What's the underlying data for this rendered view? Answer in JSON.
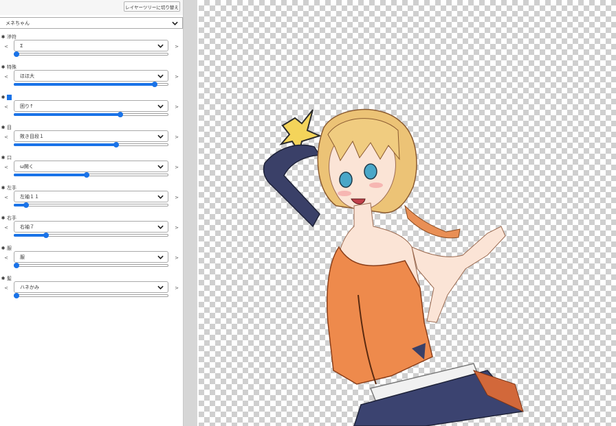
{
  "toolbar": {
    "switch_label": "レイヤーツリーに切り替え"
  },
  "character_select": {
    "value": "メネちゃん"
  },
  "groups": [
    {
      "title": "滲符",
      "value": "Σ",
      "level": 0.0
    },
    {
      "title": "特殊",
      "value": "ほほ大",
      "level": 0.91
    },
    {
      "title": "",
      "value": "困り↑",
      "level": 0.69
    },
    {
      "title": "目",
      "value": "敗き目段１",
      "level": 0.66
    },
    {
      "title": "口",
      "value": "ω開く",
      "level": 0.47
    },
    {
      "title": "左手",
      "value": "左袖１１",
      "level": 0.08
    },
    {
      "title": "右手",
      "value": "右袖７",
      "level": 0.21
    },
    {
      "title": "服",
      "value": "服",
      "level": 0.0
    },
    {
      "title": "髪",
      "value": "ハネかみ",
      "level": 0.0
    }
  ],
  "nav": {
    "prev": "<",
    "next": ">"
  },
  "colors": {
    "accent": "#1a73e8",
    "panel_bg": "#ffffff",
    "gutter": "#d6d6d6",
    "checker": "#cfcfcf"
  },
  "icons": {
    "dropdown": "chevron-down-icon",
    "group_marker": "asterisk-icon"
  }
}
